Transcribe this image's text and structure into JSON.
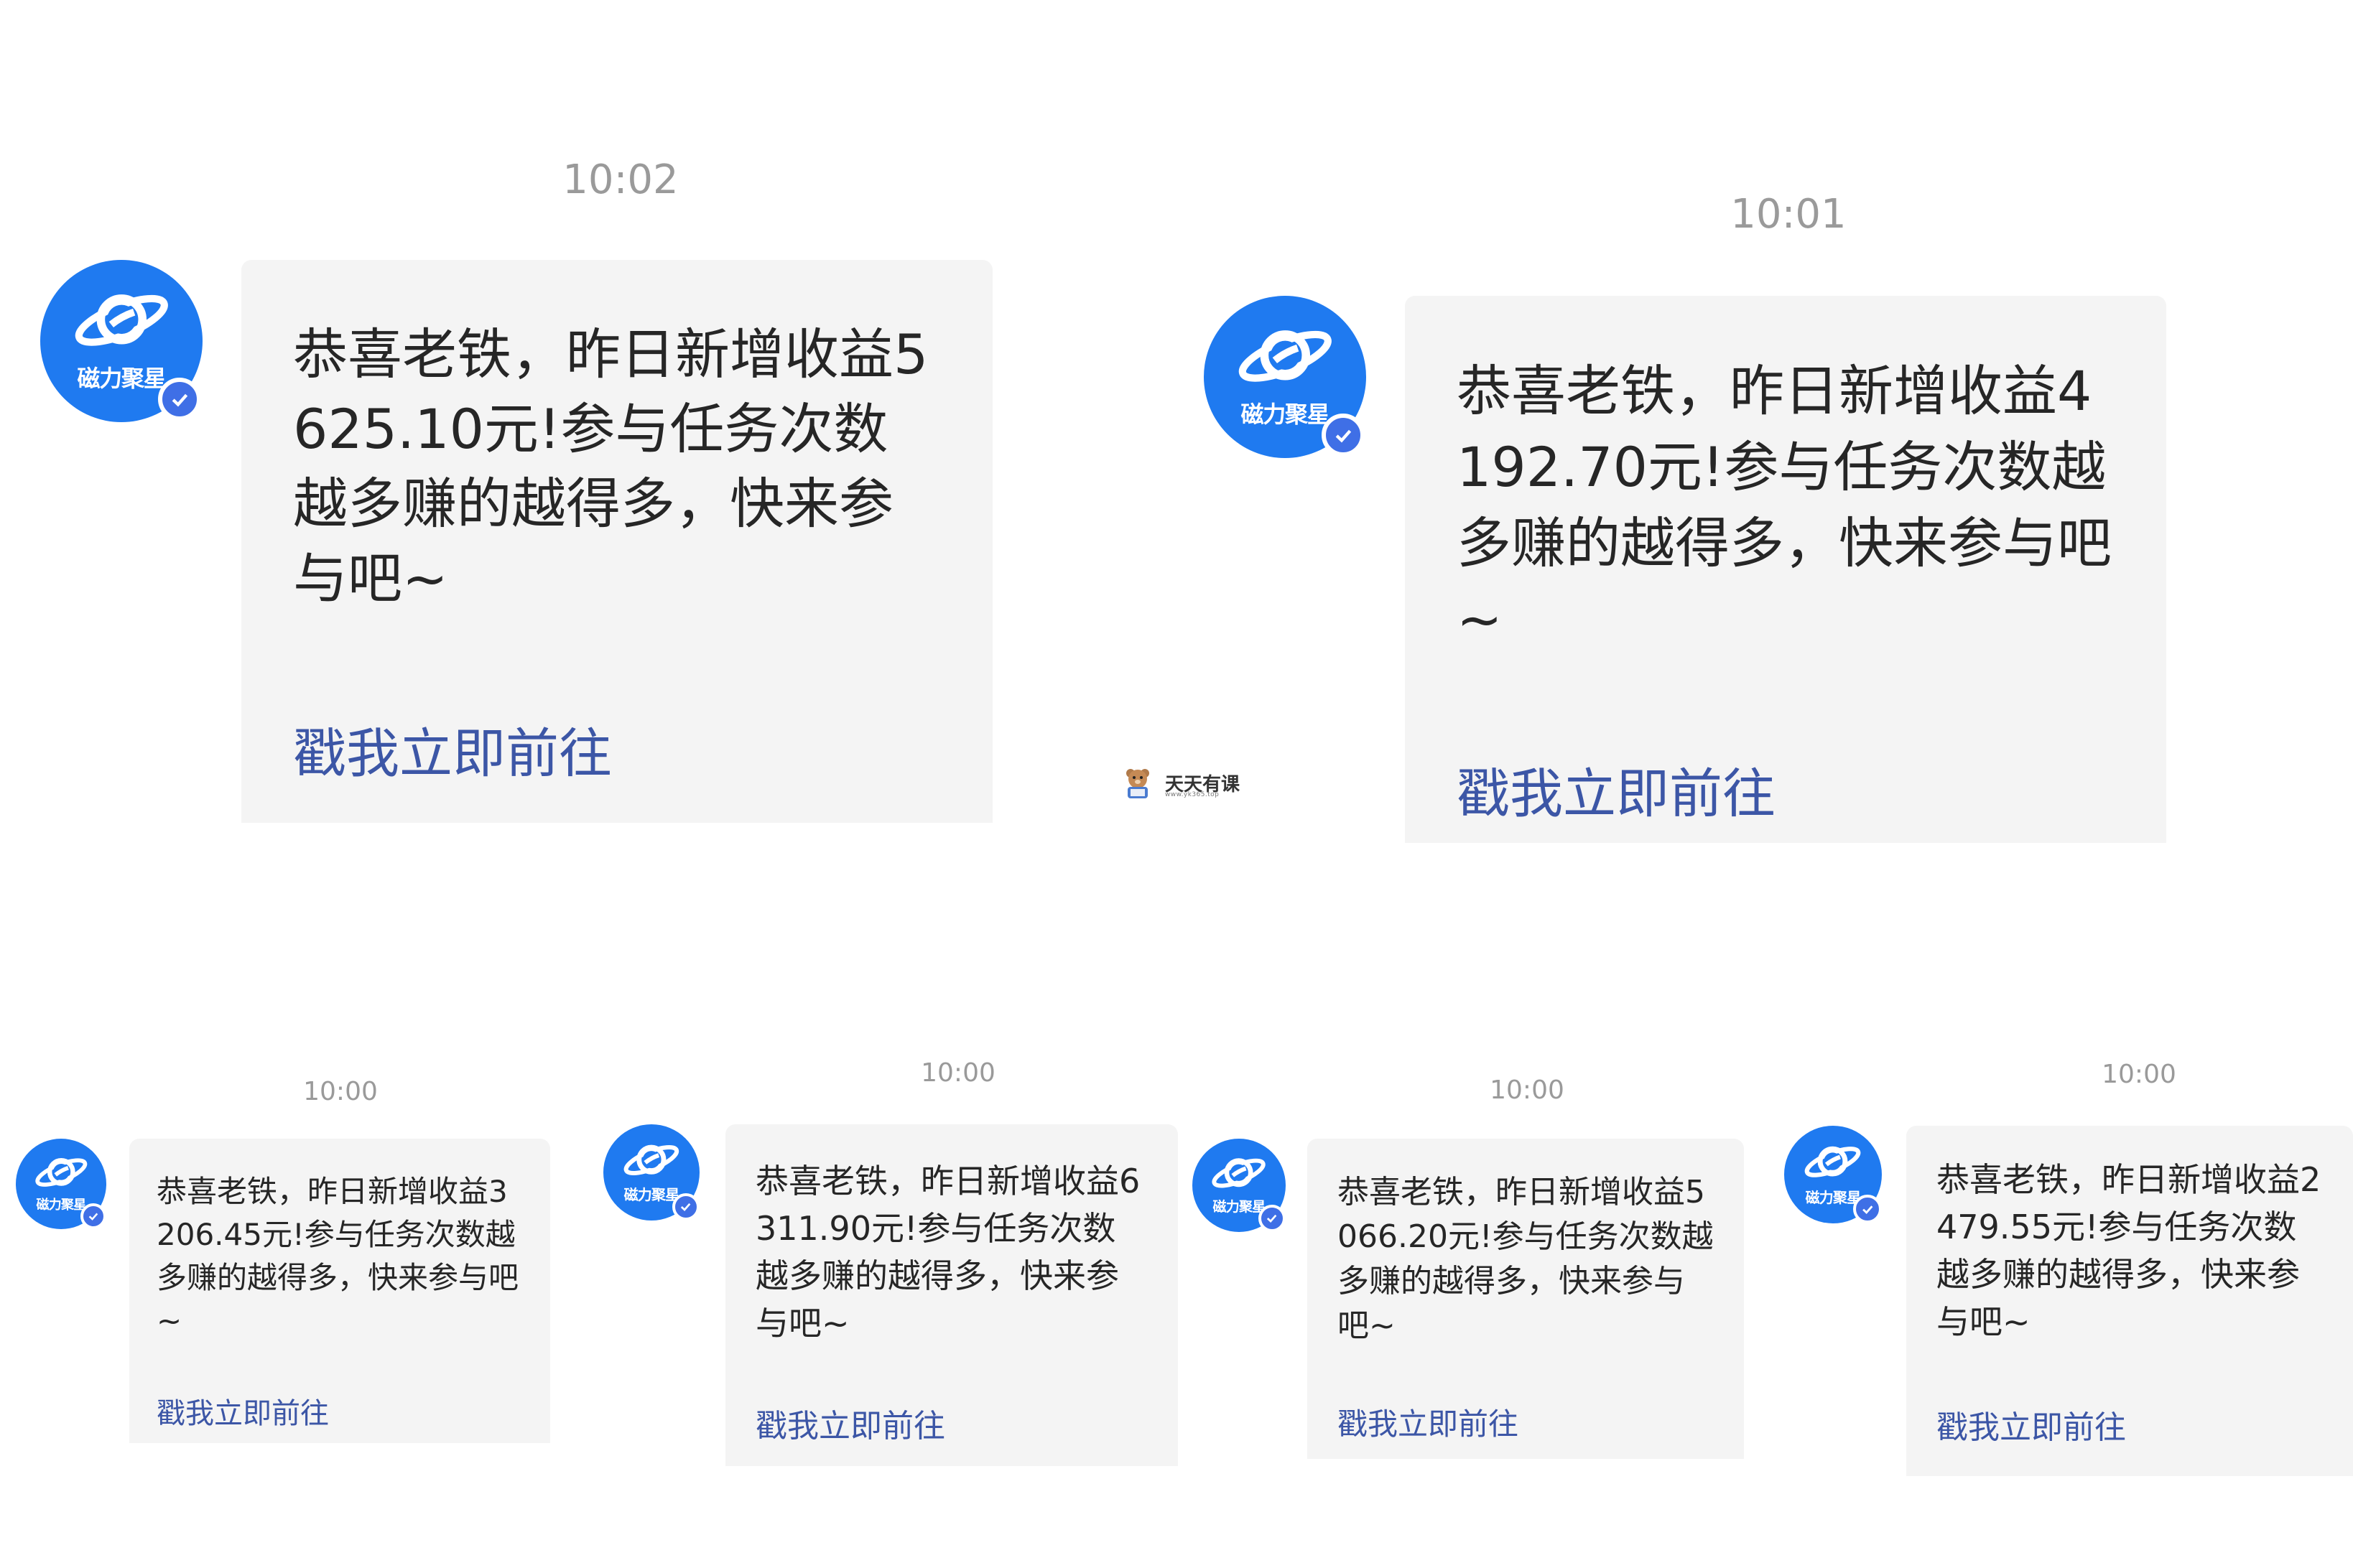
{
  "app": {
    "sender_name": "磁力聚星",
    "brand_color": "#1f7af0",
    "link_color": "#3c56a6",
    "bubble_color": "#f4f4f4"
  },
  "messages": [
    {
      "time": "10:02",
      "text": "恭喜老铁，昨日新增收益5625.10元!参与任务次数越多赚的越得多，快来参与吧~",
      "link": "戳我立即前往"
    },
    {
      "time": "10:01",
      "text": "恭喜老铁，昨日新增收益4192.70元!参与任务次数越多赚的越得多，快来参与吧~",
      "link": "戳我立即前往"
    },
    {
      "time": "10:00",
      "text": "恭喜老铁，昨日新增收益3206.45元!参与任务次数越多赚的越得多，快来参与吧~",
      "link": "戳我立即前往"
    },
    {
      "time": "10:00",
      "text": "恭喜老铁，昨日新增收益6311.90元!参与任务次数越多赚的越得多，快来参与吧~",
      "link": "戳我立即前往"
    },
    {
      "time": "10:00",
      "text": "恭喜老铁，昨日新增收益5066.20元!参与任务次数越多赚的越得多，快来参与吧~",
      "link": "戳我立即前往"
    },
    {
      "time": "10:00",
      "text": "恭喜老铁，昨日新增收益2479.55元!参与任务次数越多赚的越得多，快来参与吧~",
      "link": "戳我立即前往"
    }
  ],
  "watermark": {
    "title": "天天有课",
    "url": "www.yk365.top"
  }
}
